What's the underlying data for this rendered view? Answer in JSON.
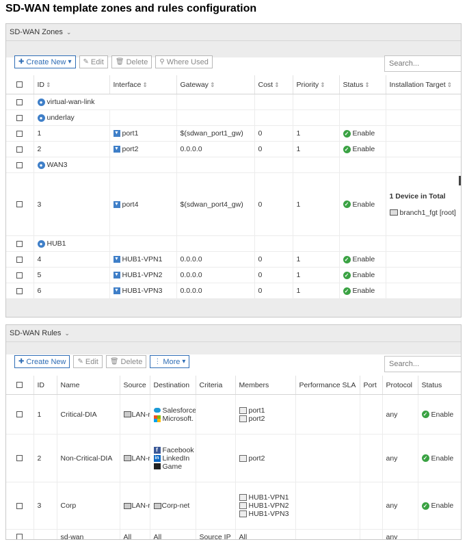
{
  "page_title": "SD-WAN template zones and rules configuration",
  "zones": {
    "header_label": "SD-WAN Zones",
    "toolbar": {
      "create_new": "Create New",
      "edit": "Edit",
      "delete": "Delete",
      "where_used": "Where Used"
    },
    "search_placeholder": "Search...",
    "columns": [
      "ID",
      "Interface",
      "Gateway",
      "Cost",
      "Priority",
      "Status",
      "Installation Target"
    ],
    "rows": [
      {
        "type": "zone",
        "id": "virtual-wan-link"
      },
      {
        "type": "zone",
        "id": "underlay"
      },
      {
        "type": "member",
        "id": "1",
        "interface": "port1",
        "gateway": "$(sdwan_port1_gw)",
        "cost": "0",
        "priority": "1",
        "status": "Enable"
      },
      {
        "type": "member",
        "id": "2",
        "interface": "port2",
        "gateway": "0.0.0.0",
        "cost": "0",
        "priority": "1",
        "status": "Enable"
      },
      {
        "type": "zone",
        "id": "WAN3"
      },
      {
        "type": "member",
        "id": "3",
        "interface": "port4",
        "gateway": "$(sdwan_port4_gw)",
        "cost": "0",
        "priority": "1",
        "status": "Enable",
        "target_title": "1 Device in Total",
        "target_device": "branch1_fgt [root]"
      },
      {
        "type": "zone",
        "id": "HUB1"
      },
      {
        "type": "member",
        "id": "4",
        "interface": "HUB1-VPN1",
        "gateway": "0.0.0.0",
        "cost": "0",
        "priority": "1",
        "status": "Enable"
      },
      {
        "type": "member",
        "id": "5",
        "interface": "HUB1-VPN2",
        "gateway": "0.0.0.0",
        "cost": "0",
        "priority": "1",
        "status": "Enable"
      },
      {
        "type": "member",
        "id": "6",
        "interface": "HUB1-VPN3",
        "gateway": "0.0.0.0",
        "cost": "0",
        "priority": "1",
        "status": "Enable"
      }
    ]
  },
  "rules": {
    "header_label": "SD-WAN Rules",
    "toolbar": {
      "create_new": "Create New",
      "edit": "Edit",
      "delete": "Delete",
      "more": "More"
    },
    "search_placeholder": "Search...",
    "columns": [
      "ID",
      "Name",
      "Source",
      "Destination",
      "Criteria",
      "Members",
      "Performance SLA",
      "Port",
      "Protocol",
      "Status"
    ],
    "rows": [
      {
        "id": "1",
        "name": "Critical-DIA",
        "source": "LAN-r",
        "destination": [
          {
            "icon": "salesforce-icon",
            "label": "Salesforce"
          },
          {
            "icon": "microsoft-icon",
            "label": "Microsoft."
          }
        ],
        "criteria": "",
        "members": [
          "port1",
          "port2"
        ],
        "sla": "",
        "port": "",
        "protocol": "any",
        "status": "Enable"
      },
      {
        "id": "2",
        "name": "Non-Critical-DIA",
        "source": "LAN-r",
        "destination": [
          {
            "icon": "facebook-icon",
            "label": "Facebook"
          },
          {
            "icon": "linkedin-icon",
            "label": "LinkedIn"
          },
          {
            "icon": "game-icon",
            "label": "Game"
          }
        ],
        "criteria": "",
        "members": [
          "port2"
        ],
        "sla": "",
        "port": "",
        "protocol": "any",
        "status": "Enable"
      },
      {
        "id": "3",
        "name": "Corp",
        "source": "LAN-r",
        "destination": [
          {
            "icon": "address-icon",
            "label": "Corp-net"
          }
        ],
        "criteria": "",
        "members": [
          "HUB1-VPN1",
          "HUB1-VPN2",
          "HUB1-VPN3"
        ],
        "sla": "",
        "port": "",
        "protocol": "any",
        "status": "Enable"
      },
      {
        "id": "",
        "name": "sd-wan",
        "source": "All",
        "destination_text": "All",
        "criteria": "Source IP",
        "members_text": "All",
        "sla": "",
        "port": "",
        "protocol": "any",
        "status": ""
      }
    ]
  }
}
